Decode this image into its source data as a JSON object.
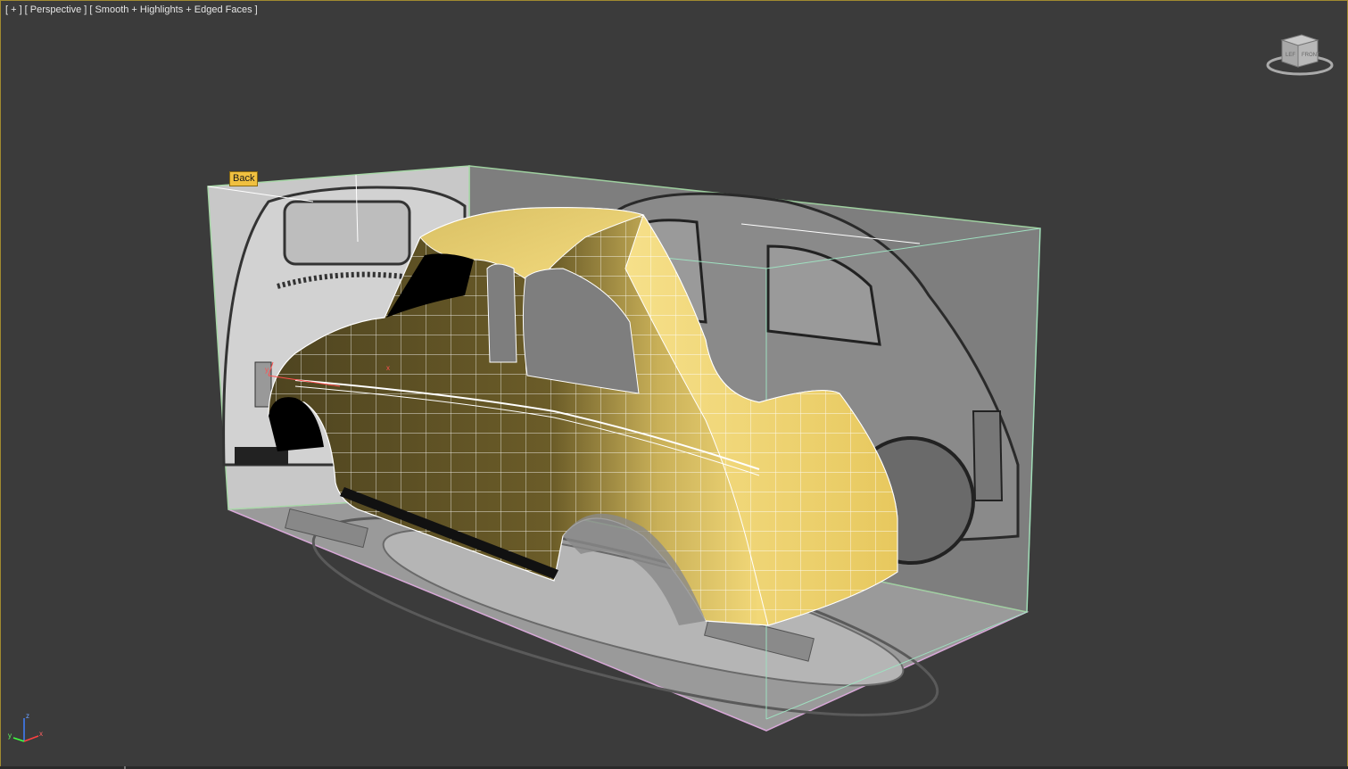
{
  "viewport": {
    "label_parts": [
      "[ + ]",
      "[ Perspective ]",
      "[ Smooth + Highlights + Edged Faces ]"
    ],
    "active_border_color": "#a08a30",
    "background_color": "#3b3b3b"
  },
  "scene": {
    "back_plane_tag": "Back",
    "model_color": "#e8d070",
    "model_shadow_color": "#5a4f22",
    "wire_color": "#ffffff",
    "bbox_color": "#9fe0c0",
    "ref_plane_color": "#b0b0b0"
  },
  "viewcube": {
    "icon": "viewcube-icon",
    "front_letter": "FRONT"
  },
  "axis_tripod": {
    "x_label": "x",
    "y_label": "y",
    "z_label": "z",
    "x_color": "#ff4040",
    "y_color": "#40ff40",
    "z_color": "#4080ff"
  }
}
